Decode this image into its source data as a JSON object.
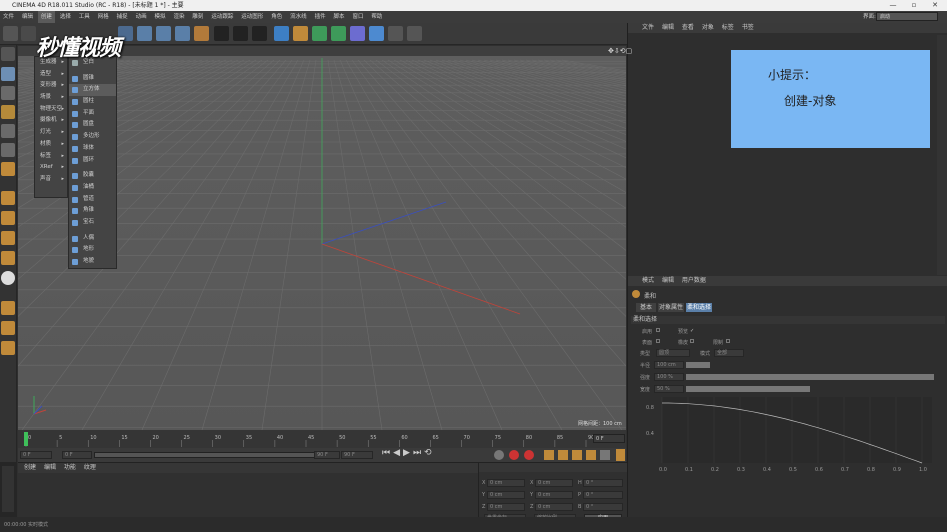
{
  "window": {
    "title": "CINEMA 4D R18.011 Studio (RC - R18) - [未标题 1 *] - 主要"
  },
  "menubar": {
    "items": [
      "文件",
      "编辑",
      "创建",
      "选择",
      "工具",
      "网格",
      "捕捉",
      "动画",
      "模拟",
      "渲染",
      "雕刻",
      "运动跟踪",
      "运动图形",
      "角色",
      "流水线",
      "插件",
      "脚本",
      "窗口",
      "帮助"
    ],
    "right_label": "界面:",
    "layout_value": "启动"
  },
  "create_menu": {
    "items": [
      "生成器",
      "造型",
      "变形器",
      "场景",
      "物理天空",
      "摄像机",
      "灯光",
      "材质",
      "标签",
      "XRef",
      "声音"
    ]
  },
  "object_submenu": {
    "header": "空白",
    "items": [
      "圆锥",
      "立方体",
      "圆柱",
      "平面",
      "圆盘",
      "多边形",
      "球体",
      "圆环",
      "胶囊",
      "油桶",
      "管道",
      "角锥",
      "宝石",
      "人偶",
      "地形",
      "地貌"
    ],
    "highlighted": "立方体"
  },
  "watermark": {
    "text": "秒懂视频"
  },
  "hint": {
    "title": "小提示：",
    "body": "创建-对象"
  },
  "viewport": {
    "grid_label": "网格间距：100 cm"
  },
  "timeline": {
    "ticks": [
      "0",
      "5",
      "10",
      "15",
      "20",
      "25",
      "30",
      "35",
      "40",
      "45",
      "50",
      "55",
      "60",
      "65",
      "70",
      "75",
      "80",
      "85",
      "90"
    ],
    "end_frame": "0 F"
  },
  "playbar": {
    "current_frame": "0 F",
    "min_frame": "0 F",
    "max_frame": "90 F",
    "end_frame": "90 F"
  },
  "material_panel": {
    "menu": [
      "创建",
      "编辑",
      "功能",
      "纹理"
    ]
  },
  "coord_panel": {
    "rows": [
      {
        "a": "X",
        "av": "0 cm",
        "b": "X",
        "bv": "0 cm",
        "c": "H",
        "cv": "0 °"
      },
      {
        "a": "Y",
        "av": "0 cm",
        "b": "Y",
        "bv": "0 cm",
        "c": "P",
        "cv": "0 °"
      },
      {
        "a": "Z",
        "av": "0 cm",
        "b": "Z",
        "bv": "0 cm",
        "c": "B",
        "cv": "0 °"
      }
    ],
    "mode": "世界坐标",
    "scale_mode": "缩放比例",
    "apply": "应用"
  },
  "object_manager": {
    "menu": [
      "文件",
      "编辑",
      "查看",
      "对象",
      "标签",
      "书签"
    ]
  },
  "attr_manager": {
    "menu": [
      "模式",
      "编辑",
      "用户数据"
    ],
    "object_label": "柔和",
    "tabs": [
      "基本",
      "对象属性",
      "柔和选择"
    ],
    "section": "柔和选择",
    "fields": [
      {
        "label": "启用",
        "value": ""
      },
      {
        "label": "预览",
        "value": ""
      },
      {
        "label": "表面",
        "value": ""
      },
      {
        "label": "橡皮",
        "value": ""
      },
      {
        "label": "限制",
        "value": ""
      },
      {
        "label": "类型",
        "value": "圆顶"
      },
      {
        "label": "模式",
        "value": "全部"
      },
      {
        "label": "半径",
        "value": "100 cm"
      },
      {
        "label": "强度",
        "value": "100 %"
      },
      {
        "label": "宽度",
        "value": "50 %"
      }
    ],
    "curve_x_ticks": [
      "0.0",
      "0.1",
      "0.2",
      "0.3",
      "0.4",
      "0.5",
      "0.6",
      "0.7",
      "0.8",
      "0.9",
      "1.0"
    ],
    "curve_y_ticks": [
      "0.8",
      "0.4"
    ]
  },
  "status": {
    "text": "00:00:00 实时模式"
  },
  "colors": {
    "accent": "#7ab7f3",
    "panel": "#2e2e2e",
    "viewport": "#5a5a5a"
  }
}
